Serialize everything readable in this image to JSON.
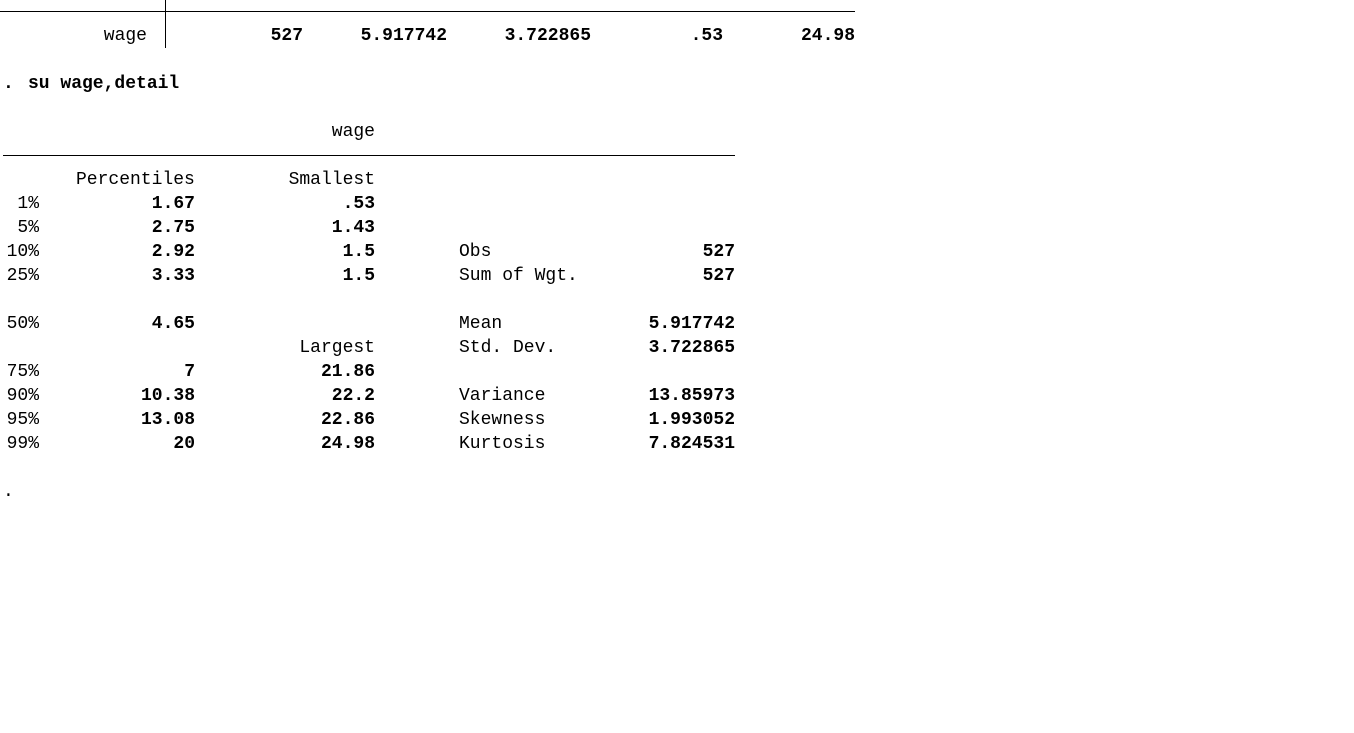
{
  "prev_summary_row": {
    "variable": "wage",
    "obs": "527",
    "mean": "5.917742",
    "std_dev": "3.722865",
    "min": ".53",
    "max": "24.98"
  },
  "command": {
    "prompt": ".",
    "text": "su wage,detail"
  },
  "detail": {
    "variable_title": "wage",
    "percentiles_header": "Percentiles",
    "smallest_header": "Smallest",
    "largest_header": "Largest",
    "rows": [
      {
        "pct": "1%",
        "pval": "1.67",
        "ext": ".53"
      },
      {
        "pct": "5%",
        "pval": "2.75",
        "ext": "1.43"
      },
      {
        "pct": "10%",
        "pval": "2.92",
        "ext": "1.5"
      },
      {
        "pct": "25%",
        "pval": "3.33",
        "ext": "1.5"
      },
      {
        "pct": "50%",
        "pval": "4.65",
        "ext": ""
      },
      {
        "pct": "75%",
        "pval": "7",
        "ext": "21.86"
      },
      {
        "pct": "90%",
        "pval": "10.38",
        "ext": "22.2"
      },
      {
        "pct": "95%",
        "pval": "13.08",
        "ext": "22.86"
      },
      {
        "pct": "99%",
        "pval": "20",
        "ext": "24.98"
      }
    ],
    "stats": {
      "obs": {
        "label": "Obs",
        "value": "527"
      },
      "sum_wgt": {
        "label": "Sum of Wgt.",
        "value": "527"
      },
      "mean": {
        "label": "Mean",
        "value": "5.917742"
      },
      "std_dev": {
        "label": "Std. Dev.",
        "value": "3.722865"
      },
      "variance": {
        "label": "Variance",
        "value": "13.85973"
      },
      "skewness": {
        "label": "Skewness",
        "value": "1.993052"
      },
      "kurtosis": {
        "label": "Kurtosis",
        "value": "7.824531"
      }
    }
  },
  "end_prompt": "."
}
